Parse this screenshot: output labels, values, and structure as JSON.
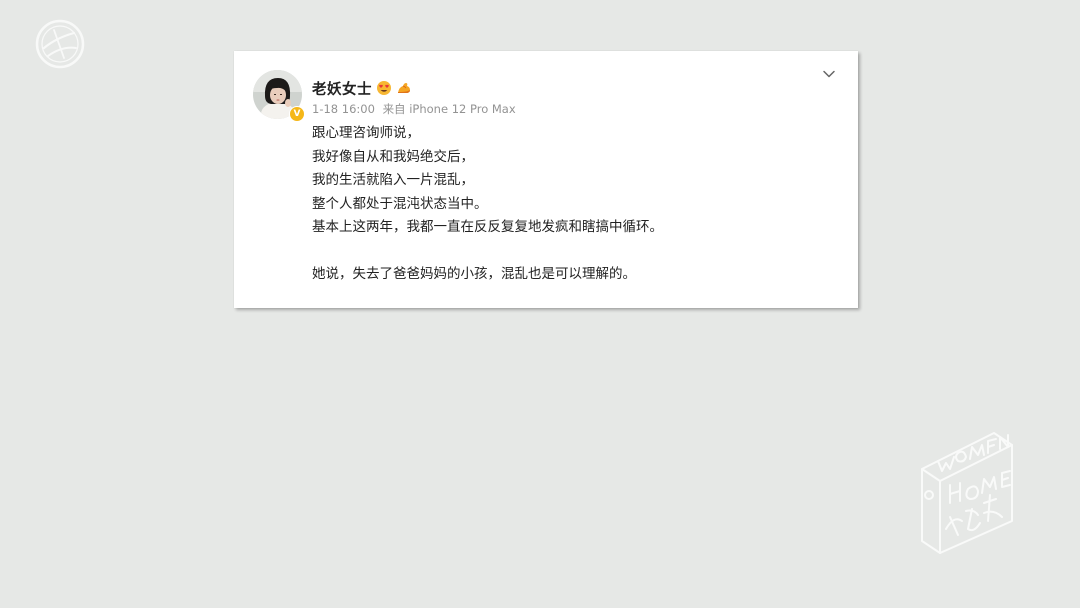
{
  "post": {
    "username": "老妖女士",
    "timestamp": "1-18 16:00",
    "source": "来自 iPhone 12 Pro Max",
    "paragraphs": [
      [
        "跟心理咨询师说，",
        "我好像自从和我妈绝交后，",
        "我的生活就陷入一片混乱，",
        "整个人都处于混沌状态当中。",
        "基本上这两年，我都一直在反反复复地发疯和瞎搞中循环。"
      ],
      [
        "她说，失去了爸爸妈妈的小孩，混乱也是可以理解的。"
      ]
    ],
    "icons": {
      "badge": "verified-badge-icon",
      "emoji_1": "heart-eyes-emoji-icon",
      "emoji_2": "flexed-arm-emoji-icon",
      "menu": "chevron-down-icon"
    }
  },
  "colors": {
    "background": "#e6e8e6",
    "card": "#ffffff",
    "text": "#222222",
    "meta": "#939393",
    "badge": "#f5b718"
  }
}
